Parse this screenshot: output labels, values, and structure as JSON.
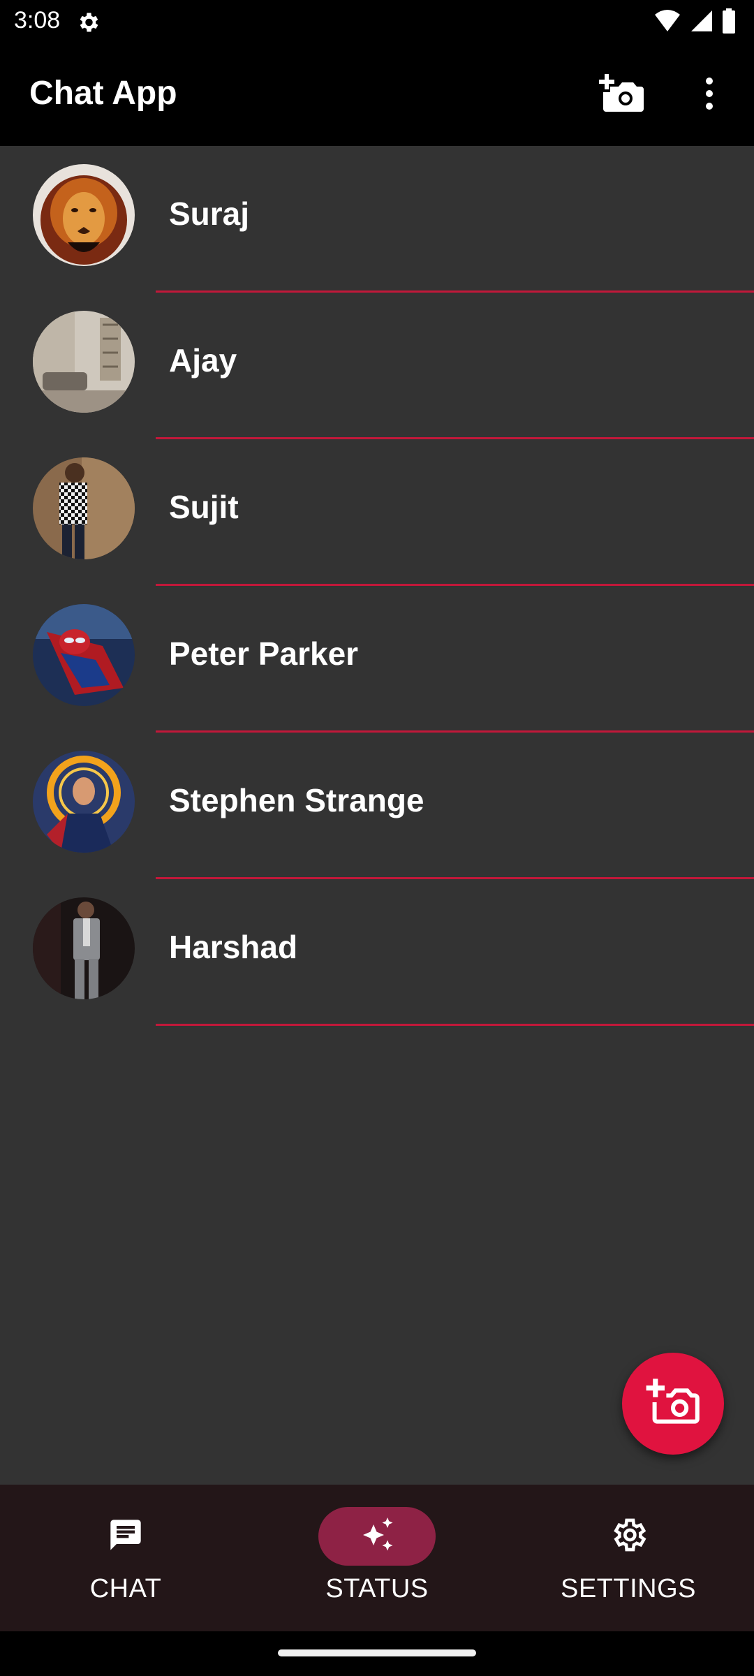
{
  "status_bar": {
    "time": "3:08",
    "icons": [
      "gear-icon",
      "wifi-icon",
      "signal-icon",
      "battery-icon"
    ]
  },
  "app_bar": {
    "title": "Chat App",
    "actions": [
      "add-photo-icon",
      "more-vert-icon"
    ]
  },
  "contacts": [
    {
      "name": "Suraj",
      "avatar": "lion-avatar"
    },
    {
      "name": "Ajay",
      "avatar": "room-avatar"
    },
    {
      "name": "Sujit",
      "avatar": "checkered-shirt-avatar"
    },
    {
      "name": "Peter Parker",
      "avatar": "spiderman-avatar"
    },
    {
      "name": "Stephen Strange",
      "avatar": "doctor-strange-avatar"
    },
    {
      "name": "Harshad",
      "avatar": "grey-suit-avatar"
    }
  ],
  "fab": {
    "icon": "add-photo-icon"
  },
  "bottom_nav": {
    "items": [
      {
        "label": "CHAT",
        "icon": "chat-icon",
        "active": false
      },
      {
        "label": "STATUS",
        "icon": "sparkle-icon",
        "active": true
      },
      {
        "label": "SETTINGS",
        "icon": "settings-icon",
        "active": false
      }
    ]
  },
  "colors": {
    "accent": "#e0133f",
    "divider": "#c2183a",
    "background": "#333333",
    "bar": "#000000",
    "nav_bg": "#231618",
    "nav_active": "#8e2245"
  }
}
